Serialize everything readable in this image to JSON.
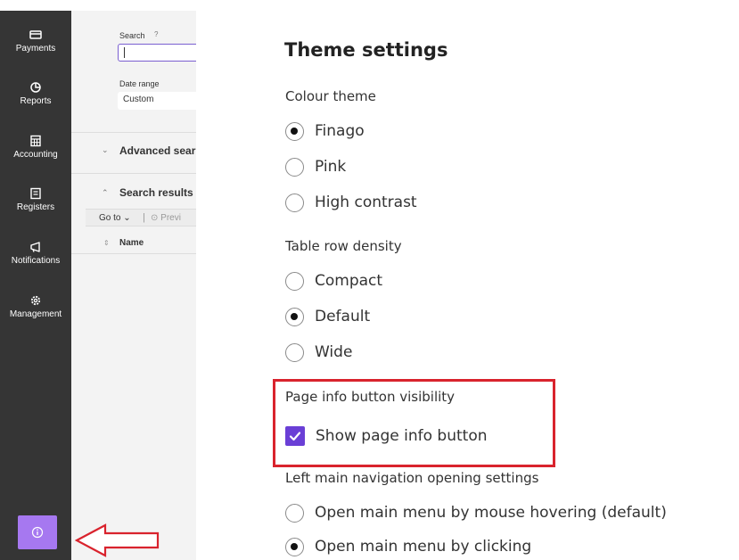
{
  "sidebar": {
    "items": [
      {
        "label": "Payments",
        "icon": "card-icon"
      },
      {
        "label": "Reports",
        "icon": "pie-chart-icon"
      },
      {
        "label": "Accounting",
        "icon": "calculator-icon"
      },
      {
        "label": "Registers",
        "icon": "register-book-icon"
      },
      {
        "label": "Notifications",
        "icon": "megaphone-icon"
      },
      {
        "label": "Management",
        "icon": "gear-icon"
      }
    ],
    "info_button_icon": "info-icon"
  },
  "app": {
    "search_label": "Search",
    "search_value": "",
    "date_range_label": "Date range",
    "date_range_value": "Custom",
    "advanced_search": "Advanced sear",
    "search_results": "Search results",
    "goto_label": "Go to",
    "preview_label": "Previ",
    "name_col": "Name"
  },
  "theme": {
    "title": "Theme settings",
    "colour_theme": {
      "label": "Colour theme",
      "options": [
        "Finago",
        "Pink",
        "High contrast"
      ],
      "selected": "Finago"
    },
    "density": {
      "label": "Table row density",
      "options": [
        "Compact",
        "Default",
        "Wide"
      ],
      "selected": "Default"
    },
    "page_info": {
      "label": "Page info button visibility",
      "checkbox_label": "Show page info button",
      "checked": true
    },
    "left_nav": {
      "label": "Left main navigation opening settings",
      "options": [
        "Open main menu by mouse hovering (default)",
        "Open main menu by clicking"
      ],
      "selected": "Open main menu by clicking"
    }
  },
  "colors": {
    "sidebar_bg": "#353535",
    "accent": "#6a3fd6",
    "info_button": "#a678f0",
    "annotation_red": "#d9232d"
  }
}
